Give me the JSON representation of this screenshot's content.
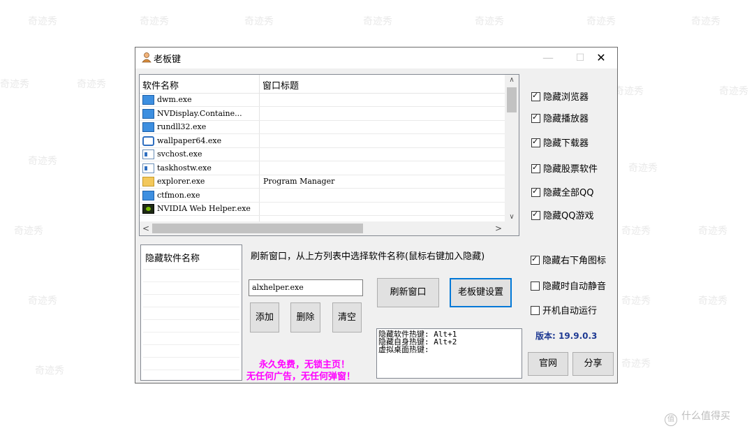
{
  "watermark": {
    "text": "奇迹秀"
  },
  "corner_watermark": {
    "symbol": "值",
    "text": "什么值得买"
  },
  "window": {
    "title": "老板键",
    "minimize": "—",
    "maximize": "☐",
    "close": "✕"
  },
  "process_list": {
    "col_name": "软件名称",
    "col_title": "窗口标题",
    "rows": [
      {
        "name": "dwm.exe",
        "title": "",
        "icon": "monitor-icon"
      },
      {
        "name": "NVDisplay.Containe...",
        "title": "",
        "icon": "monitor-icon"
      },
      {
        "name": "rundll32.exe",
        "title": "",
        "icon": "monitor-icon"
      },
      {
        "name": "wallpaper64.exe",
        "title": "",
        "icon": "wallpaper-icon"
      },
      {
        "name": "svchost.exe",
        "title": "",
        "icon": "service-icon"
      },
      {
        "name": "taskhostw.exe",
        "title": "",
        "icon": "service-icon"
      },
      {
        "name": "explorer.exe",
        "title": "Program Manager",
        "icon": "folder-icon"
      },
      {
        "name": "ctfmon.exe",
        "title": "",
        "icon": "monitor-icon"
      },
      {
        "name": "NVIDIA Web Helper.exe",
        "title": "",
        "icon": "nvidia-icon"
      }
    ],
    "scroll_up": "∧",
    "scroll_down": "∨",
    "scroll_left": "<",
    "scroll_right": ">"
  },
  "options_top": [
    {
      "label": "隐藏浏览器",
      "checked": true
    },
    {
      "label": "隐藏播放器",
      "checked": true
    },
    {
      "label": "隐藏下载器",
      "checked": true
    },
    {
      "label": "隐藏股票软件",
      "checked": true
    },
    {
      "label": "隐藏全部QQ",
      "checked": true
    },
    {
      "label": "隐藏QQ游戏",
      "checked": true
    }
  ],
  "options_bottom": [
    {
      "label": "隐藏右下角图标",
      "checked": true
    },
    {
      "label": "隐藏时自动静音",
      "checked": false
    },
    {
      "label": "开机自动运行",
      "checked": false
    }
  ],
  "hidden_list": {
    "header": "隐藏软件名称"
  },
  "instruction": "刷新窗口，从上方列表中选择软件名称(鼠标右键加入隐藏)",
  "input": {
    "value": "alxhelper.exe"
  },
  "buttons": {
    "add": "添加",
    "delete": "删除",
    "clear": "清空",
    "refresh": "刷新窗口",
    "settings": "老板键设置",
    "website": "官网",
    "share": "分享"
  },
  "hotkeys": {
    "line1": "隐藏软件热键: Alt+1",
    "line2": "隐藏自身热键: Alt+2",
    "line3": "虚拟桌面热键:"
  },
  "promo": {
    "line1": "永久免费，无锁主页！",
    "line2": "无任何广告，无任何弹窗！"
  },
  "version": "版本: 19.9.0.3"
}
